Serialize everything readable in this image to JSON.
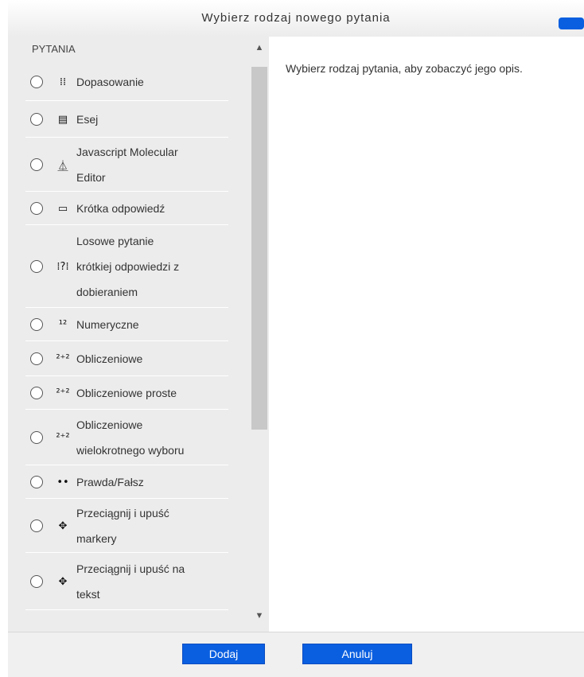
{
  "dialog": {
    "title": "Wybierz rodzaj nowego pytania",
    "section_header": "PYTANIA",
    "description": "Wybierz rodzaj pytania, aby zobaczyć jego opis.",
    "options": [
      {
        "label_lines": [
          "Dopasowanie"
        ],
        "icon": "match-icon",
        "glyph": "⁞⁞"
      },
      {
        "label_lines": [
          "Esej"
        ],
        "icon": "essay-icon",
        "glyph": "▤"
      },
      {
        "label_lines": [
          "Javascript Molecular",
          "Editor"
        ],
        "icon": "molecule-editor-icon",
        "glyph": "⏅"
      },
      {
        "label_lines": [
          "Krótka odpowiedź"
        ],
        "icon": "short-answer-icon",
        "glyph": "▭"
      },
      {
        "label_lines": [
          "Losowe pytanie",
          "krótkiej odpowiedzi z",
          "dobieraniem"
        ],
        "icon": "random-short-answer-icon",
        "glyph": "⁞?⁞"
      },
      {
        "label_lines": [
          "Numeryczne"
        ],
        "icon": "numerical-icon",
        "glyph": "¹²"
      },
      {
        "label_lines": [
          "Obliczeniowe"
        ],
        "icon": "calculated-icon",
        "glyph": "²⁺²"
      },
      {
        "label_lines": [
          "Obliczeniowe proste"
        ],
        "icon": "calculated-simple-icon",
        "glyph": "²⁺²"
      },
      {
        "label_lines": [
          "Obliczeniowe",
          "wielokrotnego wyboru"
        ],
        "icon": "calculated-multichoice-icon",
        "glyph": "²⁺²"
      },
      {
        "label_lines": [
          "Prawda/Fałsz"
        ],
        "icon": "true-false-icon",
        "glyph": "••"
      },
      {
        "label_lines": [
          "Przeciągnij i upuść",
          "markery"
        ],
        "icon": "drag-drop-markers-icon",
        "glyph": "✥"
      },
      {
        "label_lines": [
          "Przeciągnij i upuść na",
          "tekst"
        ],
        "icon": "drag-drop-text-icon",
        "glyph": "✥"
      }
    ],
    "add_label": "Dodaj",
    "cancel_label": "Anuluj"
  }
}
